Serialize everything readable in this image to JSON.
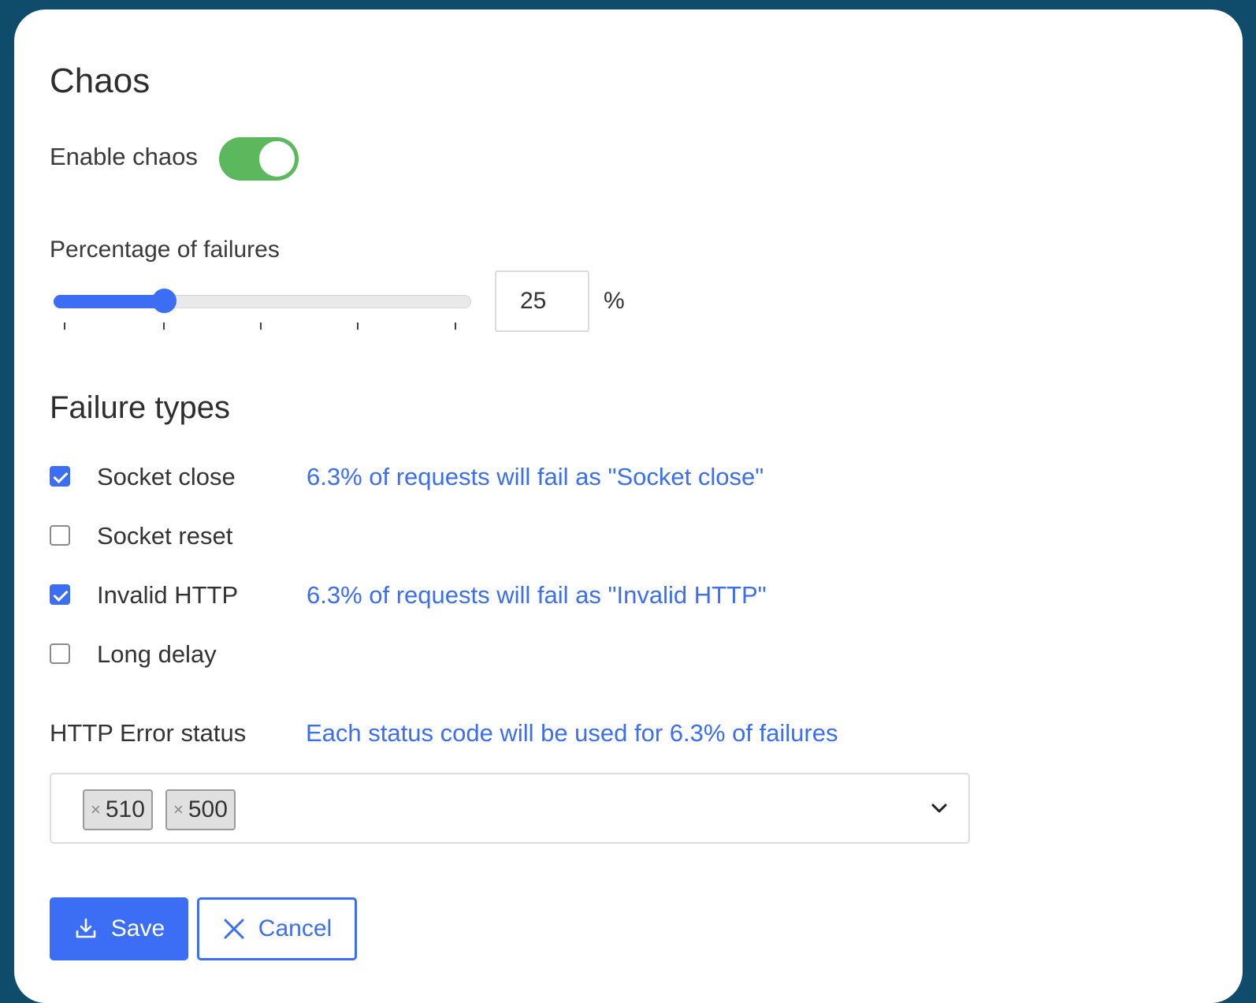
{
  "title": "Chaos",
  "enable": {
    "label": "Enable chaos",
    "on": true,
    "color": "#5cb85c"
  },
  "percentage": {
    "label": "Percentage of failures",
    "value": "25",
    "unit": "%",
    "slider_fraction": 0.25
  },
  "failure_types": {
    "heading": "Failure types",
    "items": [
      {
        "label": "Socket close",
        "checked": true,
        "info": "6.3% of requests will fail as \"Socket close\""
      },
      {
        "label": "Socket reset",
        "checked": false,
        "info": ""
      },
      {
        "label": "Invalid HTTP",
        "checked": true,
        "info": "6.3% of requests will fail as \"Invalid HTTP\""
      },
      {
        "label": "Long delay",
        "checked": false,
        "info": ""
      }
    ]
  },
  "http_error": {
    "label": "HTTP Error status",
    "info": "Each status code will be used for 6.3% of failures",
    "chips": [
      {
        "remove": "×",
        "value": "510"
      },
      {
        "remove": "×",
        "value": "500"
      }
    ],
    "dropdown_icon": "chevron-down-icon"
  },
  "buttons": {
    "save": {
      "label": "Save",
      "icon": "download-icon"
    },
    "cancel": {
      "label": "Cancel",
      "icon": "close-icon"
    }
  },
  "colors": {
    "accent": "#3b6ef5",
    "background": "#0f4c6b",
    "toggle_on": "#5cb85c"
  }
}
